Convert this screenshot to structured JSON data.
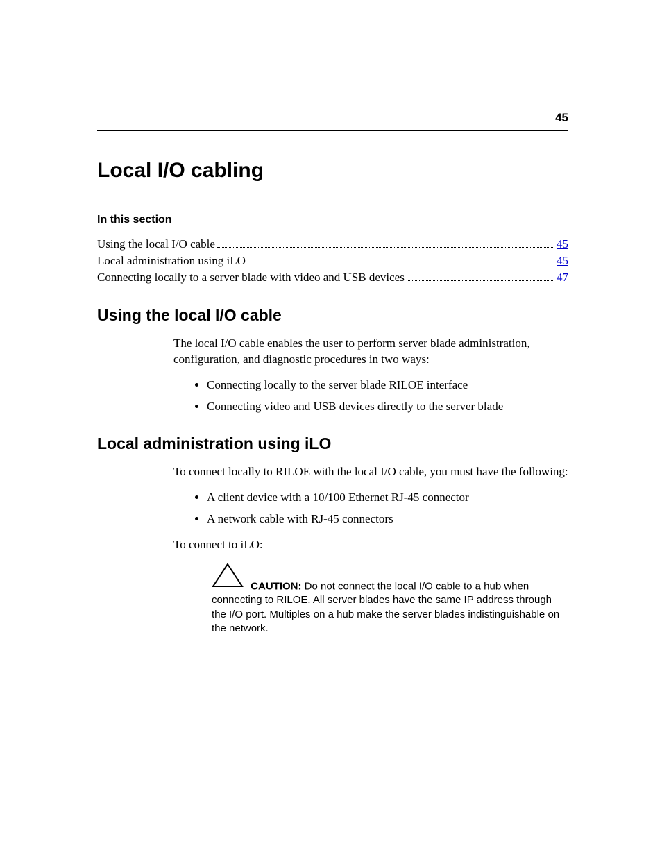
{
  "page_number": "45",
  "title": "Local I/O cabling",
  "in_this_section_label": "In this section",
  "toc": [
    {
      "label": "Using the local I/O cable",
      "page": "45"
    },
    {
      "label": "Local administration using iLO",
      "page": "45"
    },
    {
      "label": "Connecting locally to a server blade with video and USB devices",
      "page": "47"
    }
  ],
  "section1": {
    "heading": "Using the local I/O cable",
    "intro": "The local I/O cable enables the user to perform server blade administration, configuration, and diagnostic procedures in two ways:",
    "bullets": [
      "Connecting locally to the server blade RILOE interface",
      "Connecting video and USB devices directly to the server blade"
    ]
  },
  "section2": {
    "heading": "Local administration using iLO",
    "intro": "To connect locally to RILOE with the local I/O cable, you must have the following:",
    "bullets": [
      "A client device with a 10/100 Ethernet RJ-45 connector",
      "A network cable with RJ-45 connectors"
    ],
    "connect_line": "To connect to iLO:",
    "caution_label": "CAUTION:",
    "caution_text": "Do not connect the local I/O cable to a hub when connecting to RILOE. All server blades have the same IP address through the I/O port. Multiples on a hub make the server blades indistinguishable on the network."
  }
}
